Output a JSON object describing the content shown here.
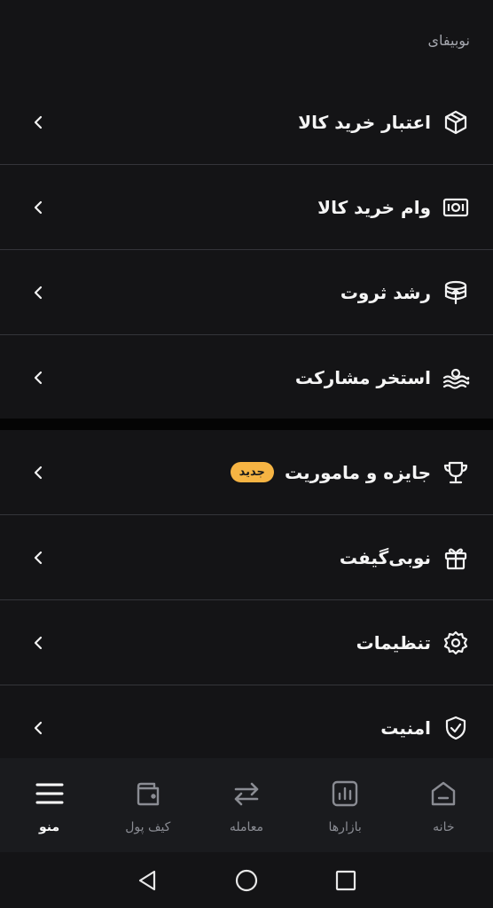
{
  "section": {
    "label": "نوبیفای"
  },
  "group1": [
    {
      "label": "اعتبار خرید کالا",
      "icon": "box-icon"
    },
    {
      "label": "وام خرید کالا",
      "icon": "cash-icon"
    },
    {
      "label": "رشد ثروت",
      "icon": "coins-stack-icon"
    },
    {
      "label": "استخر مشارکت",
      "icon": "pool-icon"
    }
  ],
  "group2": [
    {
      "label": "جایزه و ماموریت",
      "icon": "trophy-icon",
      "badge": "جدید"
    },
    {
      "label": "نوبی‌گیفت",
      "icon": "gift-icon"
    },
    {
      "label": "تنظیمات",
      "icon": "gear-icon"
    },
    {
      "label": "امنیت",
      "icon": "shield-check-icon"
    }
  ],
  "bottom_nav": [
    {
      "label": "منو",
      "icon": "hamburger-menu-icon",
      "active": true
    },
    {
      "label": "کیف پول",
      "icon": "wallet-icon",
      "active": false
    },
    {
      "label": "معامله",
      "icon": "swap-arrows-icon",
      "active": false
    },
    {
      "label": "بازارها",
      "icon": "chart-icon",
      "active": false
    },
    {
      "label": "خانه",
      "icon": "home-icon",
      "active": false
    }
  ],
  "colors": {
    "background": "#141416",
    "divider": "#34353a",
    "badge": "#f6b443",
    "nav_bg": "#1a1b1e"
  }
}
